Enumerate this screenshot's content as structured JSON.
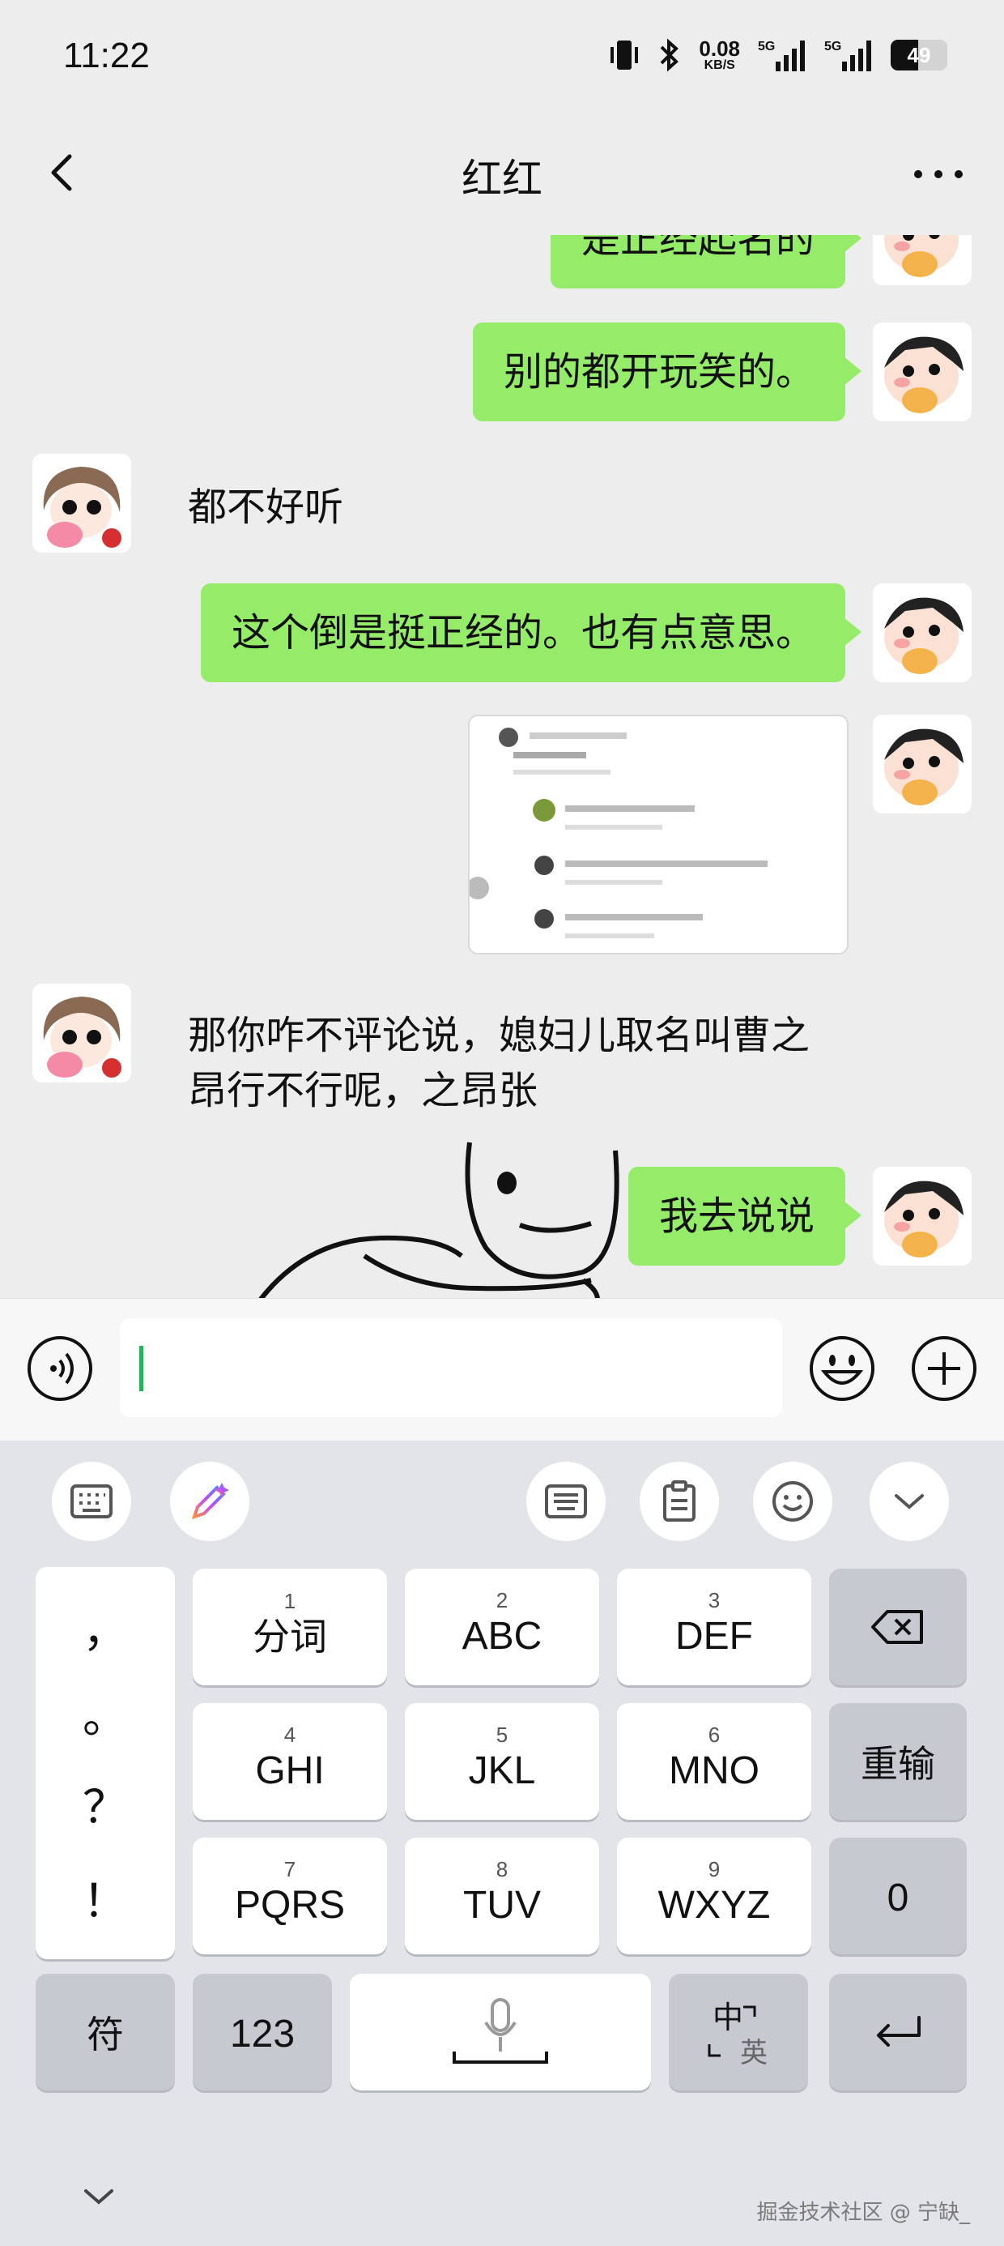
{
  "status_bar": {
    "time": "11:22",
    "net_speed_value": "0.08",
    "net_speed_unit": "KB/S",
    "signal1_label": "5G",
    "signal2_label": "5G",
    "battery_level": 49,
    "battery_label": "49",
    "icons": [
      "vibrate-icon",
      "bluetooth-icon",
      "signal-icon",
      "signal-icon",
      "battery-icon"
    ]
  },
  "header": {
    "title": "红红",
    "back_icon": "chevron-left-icon",
    "more_icon": "more-dots-icon"
  },
  "messages": [
    {
      "side": "right",
      "type": "text",
      "text": "是正经起名的"
    },
    {
      "side": "right",
      "type": "text",
      "text": "别的都开玩笑的。"
    },
    {
      "side": "left",
      "type": "text",
      "text": "都不好听"
    },
    {
      "side": "right",
      "type": "text",
      "text": "这个倒是挺正经的。也有点意思。"
    },
    {
      "side": "right",
      "type": "image",
      "text": ""
    },
    {
      "side": "left",
      "type": "text",
      "text": "那你咋不评论说，媳妇儿取名叫曹之昂行不行呢，之昂张"
    },
    {
      "side": "left",
      "type": "sticker",
      "text": ""
    },
    {
      "side": "right",
      "type": "text",
      "text": "我去说说"
    }
  ],
  "input_bar": {
    "value": "",
    "voice_icon": "voice-icon",
    "emoji_icon": "emoji-icon",
    "plus_icon": "plus-icon"
  },
  "keyboard": {
    "toolbar": [
      "keyboard-switch-icon",
      "ai-pen-icon",
      "keyboard-layout-icon",
      "clipboard-icon",
      "emoji-icon",
      "chevron-down-icon"
    ],
    "punctuation": [
      "，",
      "。",
      "？",
      "！"
    ],
    "keys": [
      {
        "num": "1",
        "label": "分词"
      },
      {
        "num": "2",
        "label": "ABC"
      },
      {
        "num": "3",
        "label": "DEF"
      },
      {
        "num": "4",
        "label": "GHI"
      },
      {
        "num": "5",
        "label": "JKL"
      },
      {
        "num": "6",
        "label": "MNO"
      },
      {
        "num": "7",
        "label": "PQRS"
      },
      {
        "num": "8",
        "label": "TUV"
      },
      {
        "num": "9",
        "label": "WXYZ"
      }
    ],
    "reinput": "重输",
    "zero": "0",
    "symbols": "符",
    "numbers": "123",
    "lang_primary": "中",
    "lang_secondary": "英",
    "watermark": "掘金技术社区 @ 宁缺_"
  },
  "colors": {
    "sent_bubble": "#95ec69",
    "chat_bg": "#ededed",
    "keyboard_bg": "#e3e4e9",
    "caret": "#2ab05a"
  }
}
